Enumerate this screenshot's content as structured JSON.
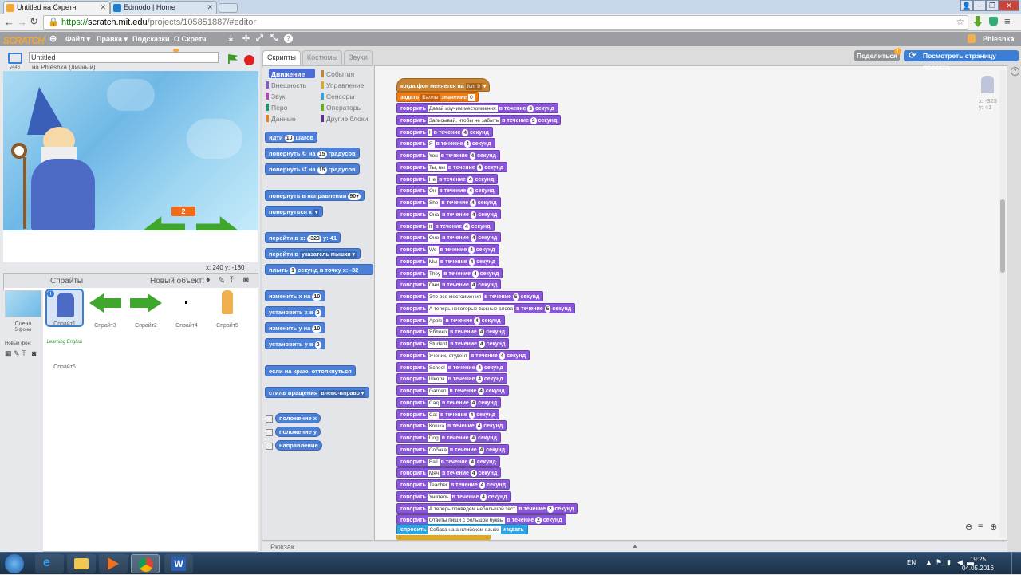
{
  "browser": {
    "tabs": [
      {
        "title": "Untitled на Скретч",
        "active": true,
        "favicon_color": "#f7a631"
      },
      {
        "title": "Edmodo | Home",
        "active": false,
        "favicon_color": "#1d7dd1"
      }
    ],
    "url_scheme": "https://",
    "url_host": "scratch.mit.edu",
    "url_path": "/projects/105851887/#editor"
  },
  "menubar": {
    "logo": "SCRATCH",
    "items": [
      "Файл ▾",
      "Правка ▾",
      "Подсказки",
      "О Скретч"
    ],
    "user": "Phleshka"
  },
  "project": {
    "title": "Untitled",
    "byline": "на Phleshka (личный)",
    "share_button": "Поделиться",
    "view_page_button": "Посмотреть страницу проекта"
  },
  "stage": {
    "variable_value": "2",
    "coords_label": "x: 240  y: -180",
    "version": "v446"
  },
  "sprites_panel": {
    "header": "Спрайты",
    "new_object": "Новый объект:",
    "scene_label": "Сцена",
    "scene_backdrops": "5 фоны",
    "new_backdrop": "Новый фон:",
    "sprites": [
      "Спрайт1",
      "Спрайт3",
      "Спрайт2",
      "Спрайт4",
      "Спрайт5",
      "Спрайт6"
    ],
    "learning_text": "Learning English"
  },
  "tabs": [
    "Скрипты",
    "Костюмы",
    "Звуки"
  ],
  "categories": [
    {
      "label": "Движение",
      "color": "#4a6cd4",
      "active": true
    },
    {
      "label": "События",
      "color": "#c88330"
    },
    {
      "label": "Внешность",
      "color": "#8a55d7"
    },
    {
      "label": "Управление",
      "color": "#e1a91a"
    },
    {
      "label": "Звук",
      "color": "#bb42c3"
    },
    {
      "label": "Сенсоры",
      "color": "#2ca5e2"
    },
    {
      "label": "Перо",
      "color": "#0e9a6c"
    },
    {
      "label": "Операторы",
      "color": "#5cb712"
    },
    {
      "label": "Данные",
      "color": "#ee7d16"
    },
    {
      "label": "Другие блоки",
      "color": "#632d99"
    }
  ],
  "palette_blocks": [
    {
      "parts": [
        "идти ",
        "10",
        " шагов"
      ]
    },
    {
      "parts": [
        "повернуть ↻ на ",
        "15",
        " градусов"
      ]
    },
    {
      "parts": [
        "повернуть ↺ на ",
        "15",
        " градусов"
      ]
    },
    {
      "parts": [
        "повернуть в направлении ",
        "90▾",
        ""
      ]
    },
    {
      "parts": [
        "повернуться к ",
        "▾",
        ""
      ]
    },
    {
      "parts": [
        "перейти в x: ",
        "-323",
        " y: 41"
      ]
    },
    {
      "parts": [
        "перейти в ",
        "указатель мышки ▾",
        ""
      ]
    },
    {
      "parts": [
        "плыть ",
        "1",
        " секунд в точку x: -32"
      ]
    },
    {
      "parts": [
        "изменить x на ",
        "10",
        ""
      ]
    },
    {
      "parts": [
        "установить x в ",
        "0",
        ""
      ]
    },
    {
      "parts": [
        "изменить y на ",
        "10",
        ""
      ]
    },
    {
      "parts": [
        "установить y в ",
        "0",
        ""
      ]
    },
    {
      "parts": [
        "если на краю, оттолкнуться",
        "",
        ""
      ]
    },
    {
      "parts": [
        "стиль вращения ",
        "влево-вправо ▾",
        ""
      ]
    }
  ],
  "reporters": [
    "положение x",
    "положение y",
    "направление"
  ],
  "script": {
    "hat": {
      "label": "когда фон меняется на ",
      "value": "fon_9"
    },
    "set_var": {
      "label": "задать ",
      "var": "Баллы",
      "mid": " значение ",
      "value": "0"
    },
    "say_word": "говорить",
    "in_for": "в течение",
    "seconds": "секунд",
    "says": [
      {
        "text": "Давай изучим местоимения",
        "secs": "3"
      },
      {
        "text": "Записывай, чтобы не забыть",
        "secs": "3"
      },
      {
        "text": "I",
        "secs": "4"
      },
      {
        "text": "Я",
        "secs": "4"
      },
      {
        "text": "You",
        "secs": "4"
      },
      {
        "text": "Ты, вы",
        "secs": "4"
      },
      {
        "text": "He",
        "secs": "4"
      },
      {
        "text": "Он",
        "secs": "4"
      },
      {
        "text": "She",
        "secs": "4"
      },
      {
        "text": "Она",
        "secs": "4"
      },
      {
        "text": "It",
        "secs": "4"
      },
      {
        "text": "Оно",
        "secs": "4"
      },
      {
        "text": "We",
        "secs": "4"
      },
      {
        "text": "Мы",
        "secs": "4"
      },
      {
        "text": "They",
        "secs": "4"
      },
      {
        "text": "Они",
        "secs": "4"
      },
      {
        "text": "Это все местоимения",
        "secs": "5"
      },
      {
        "text": "А теперь некоторые важные слова",
        "secs": "5"
      },
      {
        "text": "Apple",
        "secs": "4"
      },
      {
        "text": "Яблоко",
        "secs": "4"
      },
      {
        "text": "Student",
        "secs": "4"
      },
      {
        "text": "Ученик, студент",
        "secs": "4"
      },
      {
        "text": "School",
        "secs": "4"
      },
      {
        "text": "Школа",
        "secs": "4"
      },
      {
        "text": "Garden",
        "secs": "4"
      },
      {
        "text": "Сад",
        "secs": "4"
      },
      {
        "text": "Cat",
        "secs": "4"
      },
      {
        "text": "Кошка",
        "secs": "4"
      },
      {
        "text": "Dog",
        "secs": "4"
      },
      {
        "text": "Собака",
        "secs": "4"
      },
      {
        "text": "Ball",
        "secs": "4"
      },
      {
        "text": "Мяч",
        "secs": "4"
      },
      {
        "text": "Teacher",
        "secs": "4"
      },
      {
        "text": "Учитель",
        "secs": "4"
      },
      {
        "text": "А теперь проведем небольшой тест",
        "secs": "2"
      },
      {
        "text": "Ответы пиши с большой буквы",
        "secs": "2"
      }
    ],
    "ask": {
      "label": "спросить",
      "text": "Собака на английском языке",
      "wait": "и ждать"
    }
  },
  "sprite_info": {
    "x": "x: -323",
    "y": "y: 41"
  },
  "backpack": "Рюкзак",
  "taskbar": {
    "lang": "EN",
    "time": "19:25",
    "date": "04.05.2016"
  }
}
